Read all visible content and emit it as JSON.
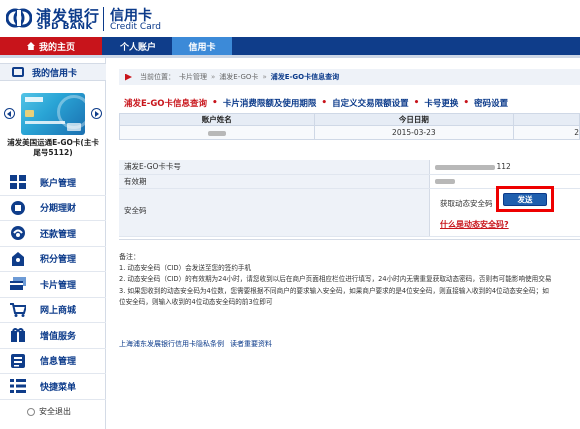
{
  "header": {
    "bank_name_cn": "浦发银行",
    "bank_name_en": "SPD BANK",
    "section_cn": "信用卡",
    "section_en": "Credit Card"
  },
  "nav": {
    "home": "我的主页",
    "tabs": [
      "个人账户",
      "信用卡"
    ],
    "active_tab": "信用卡"
  },
  "sidebar": {
    "title": "我的信用卡",
    "card_name": "浦发美国运通E-GO卡(主卡尾号5112)",
    "menu": [
      {
        "label": "账户管理",
        "icon": "account-icon"
      },
      {
        "label": "分期理财",
        "icon": "installment-icon"
      },
      {
        "label": "还款管理",
        "icon": "repayment-icon"
      },
      {
        "label": "积分管理",
        "icon": "points-icon"
      },
      {
        "label": "卡片管理",
        "icon": "card-icon"
      },
      {
        "label": "网上商城",
        "icon": "mall-icon"
      },
      {
        "label": "增值服务",
        "icon": "value-added-icon"
      },
      {
        "label": "信息管理",
        "icon": "info-icon"
      },
      {
        "label": "快捷菜单",
        "icon": "shortcut-icon"
      }
    ],
    "logout": "安全退出"
  },
  "breadcrumb": {
    "prefix": "当前位置：",
    "items": [
      "卡片管理",
      "浦发E-GO卡"
    ],
    "current": "浦发E-GO卡信息查询"
  },
  "subtabs": [
    "浦发E-GO卡信息查询",
    "卡片消费限额及使用期限",
    "自定义交易限额设置",
    "卡号更换",
    "密码设置"
  ],
  "account_table": {
    "headers": [
      "账户姓名",
      "今日日期",
      ""
    ],
    "row": [
      "",
      "2015-03-23",
      "2"
    ]
  },
  "details": {
    "card_no_label": "浦发E-GO卡卡号",
    "card_no_suffix": "112",
    "expiry_label": "有效期",
    "cid_label": "安全码",
    "get_code": "获取动态安全码",
    "send_button": "发送",
    "what_is_cid": "什么是动态安全码?"
  },
  "notes": {
    "title": "备注：",
    "lines": [
      "1. 动态安全码（CID）会发送至您的签约手机",
      "2. 动态安全码（CID）的有效期为24小时，请您收到以后在商户页面相应栏位进行填写，24小时内无需重复获取动态密码，否则有可能影响使用交易",
      "3. 如果您收到的动态安全码为4位数，您需要根据不同商户的要求输入安全码，如果商户要求的是4位安全码，则直接输入收到的4位动态安全码；如",
      "位安全码，则输入收到的4位动态安全码的前3位即可"
    ]
  },
  "footer": {
    "privacy": "上海浦东发展银行信用卡隐私条例",
    "important": "读者重要资料"
  },
  "colors": {
    "brand_blue": "#0b3a8a",
    "brand_red": "#c8141b",
    "highlight": "#ee0000"
  }
}
